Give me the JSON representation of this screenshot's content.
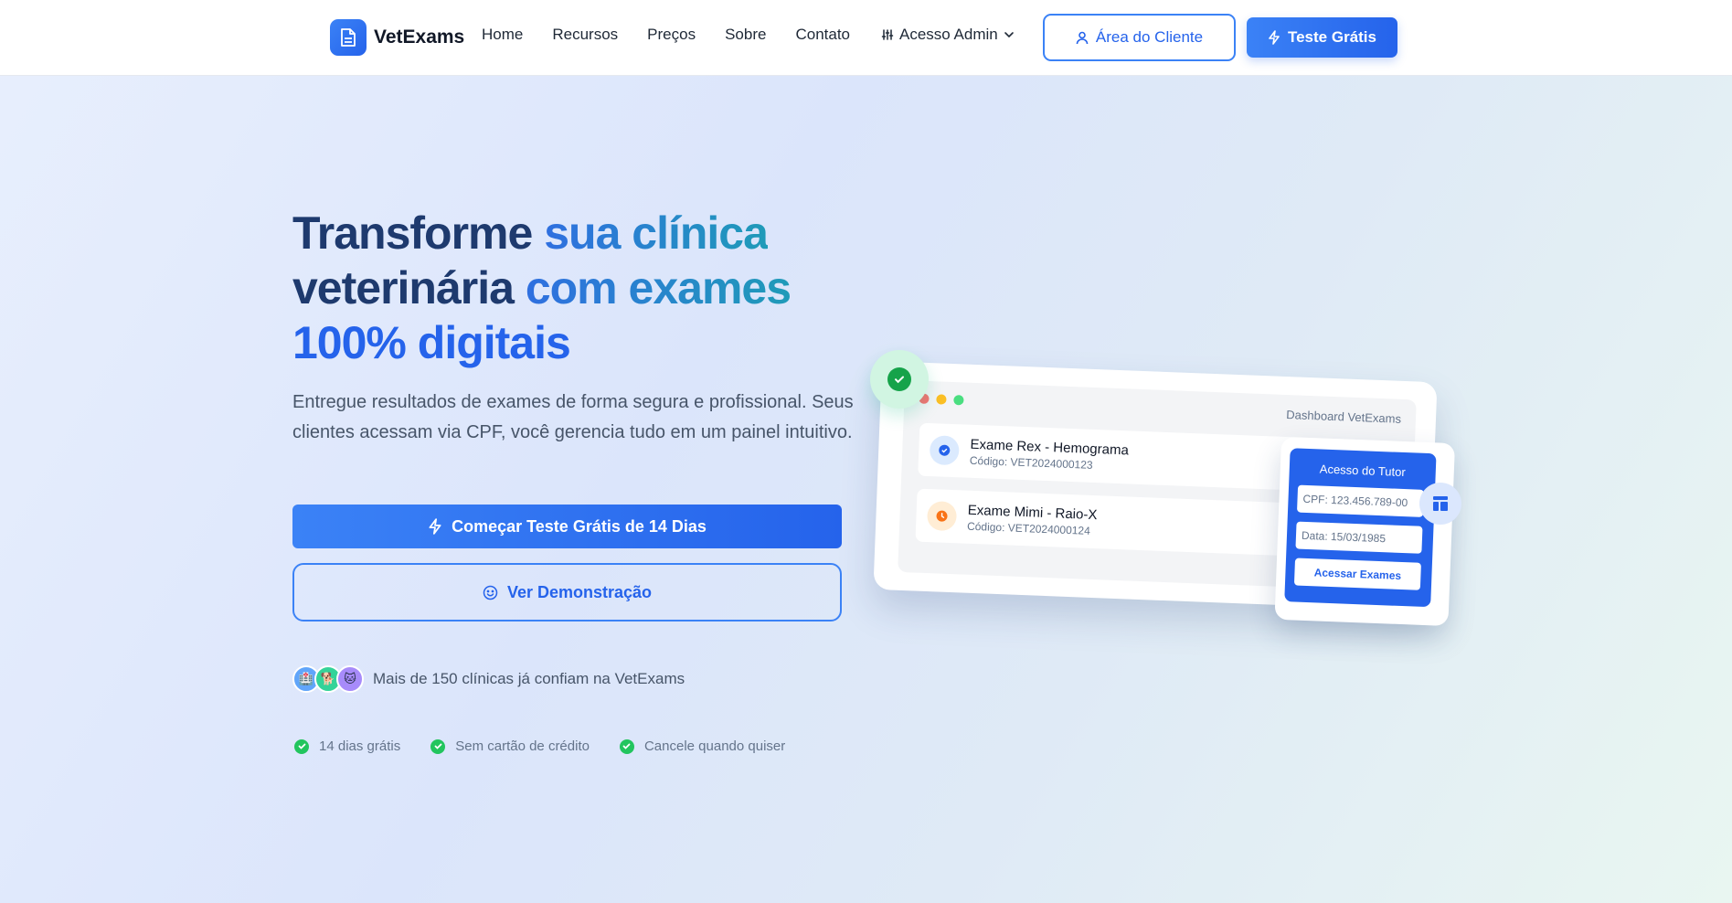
{
  "header": {
    "brand": "VetExams",
    "nav": [
      "Home",
      "Recursos",
      "Preços",
      "Sobre",
      "Contato"
    ],
    "admin_menu": "Acesso Admin",
    "client_button": "Área do Cliente",
    "trial_button": "Teste Grátis"
  },
  "hero": {
    "title_part1": "Transforme ",
    "title_part2": "sua clínica",
    "title_part3": "veterinária ",
    "title_part4": "com exames",
    "title_part5": "100% digitais",
    "subtitle": "Entregue resultados de exames de forma segura e profissional. Seus clientes acessam via CPF, você gerencia tudo em um painel intuitivo.",
    "primary_cta": "Começar Teste Grátis de 14 Dias",
    "secondary_cta": "Ver Demonstração",
    "trust_text": "Mais de 150 clínicas já confiam na VetExams",
    "avatars": [
      "🏥",
      "🐕",
      "🐱"
    ],
    "checks": [
      "14 dias grátis",
      "Sem cartão de crédito",
      "Cancele quando quiser"
    ]
  },
  "mockup": {
    "dashboard_label": "Dashboard VetExams",
    "exams": [
      {
        "title": "Exame Rex - Hemograma",
        "code": "Código: VET2024000123",
        "status": "done"
      },
      {
        "title": "Exame Mimi - Raio-X",
        "code": "Código: VET2024000124",
        "status": "pending"
      }
    ],
    "tutor": {
      "title": "Acesso do Tutor",
      "cpf_placeholder": "CPF: 123.456.789-00",
      "date_placeholder": "Data: 15/03/1985",
      "button": "Acessar Exames"
    }
  },
  "colors": {
    "primary": "#2563eb",
    "success": "#22c55e",
    "warning": "#f97316"
  }
}
